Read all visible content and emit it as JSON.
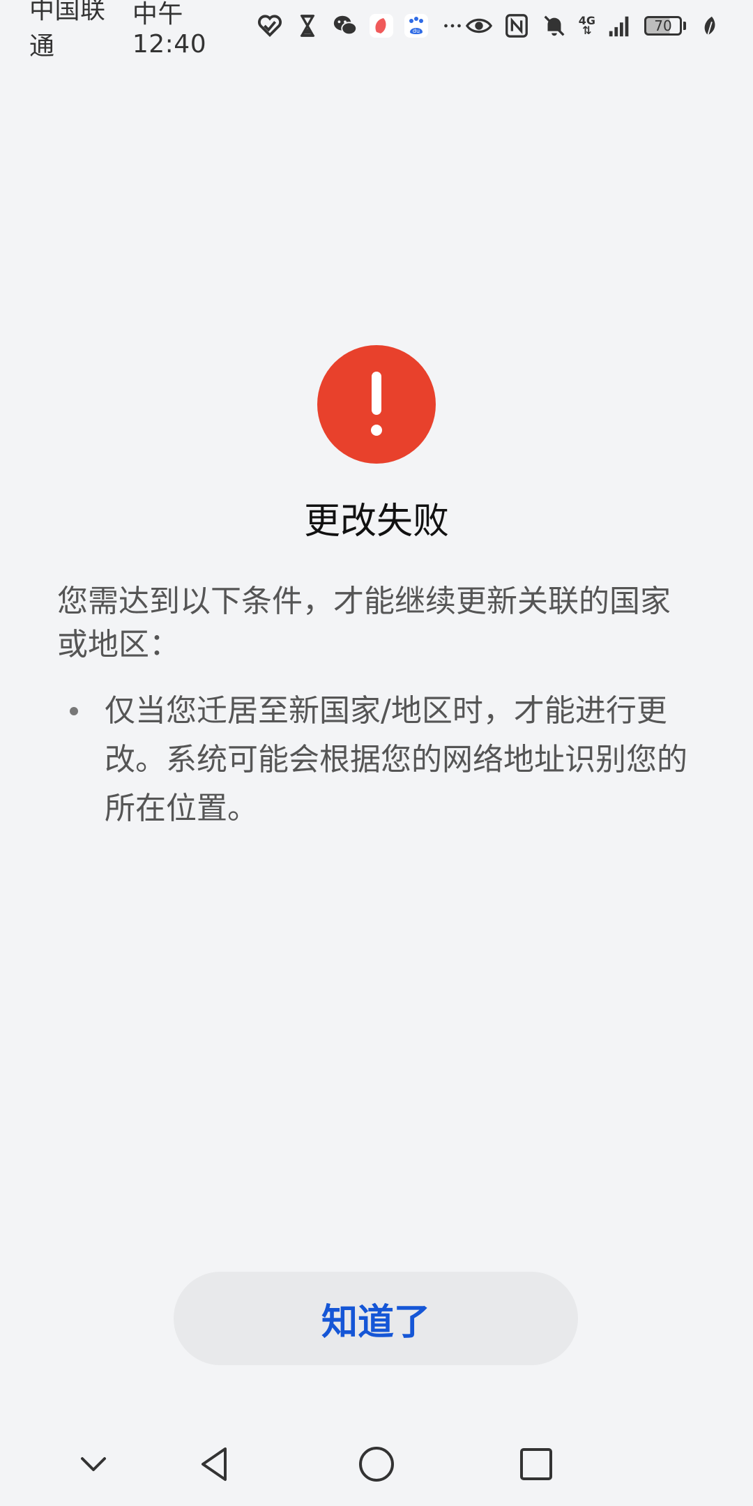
{
  "status_bar": {
    "carrier": "中国联通",
    "time": "中午12:40",
    "network_type": "4G",
    "battery_level": "70",
    "battery_percent": 70,
    "left_icons": [
      "heart-app-icon",
      "hourglass-icon",
      "wechat-icon",
      "red-app-icon",
      "baidu-icon",
      "more-icon"
    ],
    "right_icons": [
      "eye-icon",
      "nfc-icon",
      "mute-bell-icon",
      "signal-icon",
      "battery-icon",
      "leaf-icon"
    ]
  },
  "dialog": {
    "icon": "exclamation-icon",
    "icon_color": "#e8412c",
    "title": "更改失败",
    "description": "您需达到以下条件，才能继续更新关联的国家或地区：",
    "conditions": [
      "仅当您迁居至新国家/地区时，才能进行更改。系统可能会根据您的网络地址识别您的所在位置。"
    ],
    "confirm_label": "知道了",
    "confirm_color": "#1556d6"
  },
  "nav_bar": {
    "buttons": [
      "collapse-chevron-icon",
      "back-icon",
      "home-icon",
      "recents-icon"
    ]
  }
}
